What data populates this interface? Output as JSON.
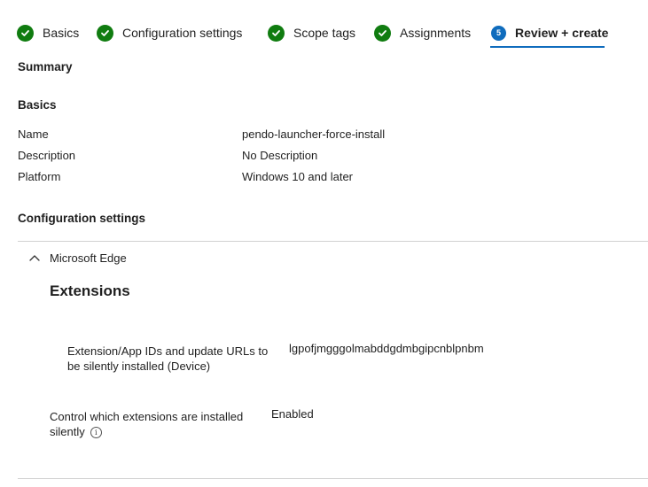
{
  "wizard": {
    "steps": [
      {
        "label": "Basics",
        "state": "complete"
      },
      {
        "label": "Configuration settings",
        "state": "complete"
      },
      {
        "label": "Scope tags",
        "state": "complete"
      },
      {
        "label": "Assignments",
        "state": "complete"
      },
      {
        "label": "Review + create",
        "state": "active",
        "number": "5"
      }
    ]
  },
  "summary_label": "Summary",
  "basics": {
    "heading": "Basics",
    "rows": [
      {
        "label": "Name",
        "value": "pendo-launcher-force-install"
      },
      {
        "label": "Description",
        "value": "No Description"
      },
      {
        "label": "Platform",
        "value": "Windows 10 and later"
      }
    ]
  },
  "config": {
    "heading": "Configuration settings",
    "group": "Microsoft Edge",
    "subheading": "Extensions",
    "settings": [
      {
        "label": "Extension/App IDs and update URLs to be silently installed (Device)",
        "value": "lgpofjmgggolmabddgdmbgipcnblpnbm"
      },
      {
        "label": "Control which extensions are installed silently",
        "value": "Enabled"
      }
    ]
  },
  "colors": {
    "complete": "#107c10",
    "active": "#0f6cbd",
    "divider": "#d1d1d1"
  },
  "icons": {
    "complete": "checkmark-circle-icon",
    "collapse": "chevron-up-icon",
    "info": "info-icon"
  }
}
